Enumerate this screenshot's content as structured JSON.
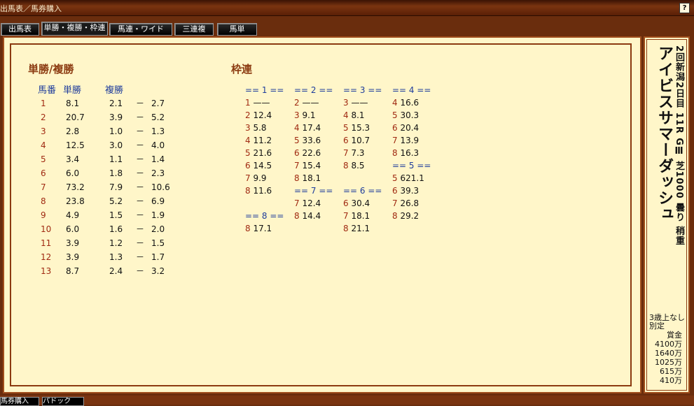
{
  "window": {
    "title": "出馬表／馬券購入",
    "help": "?"
  },
  "tabs": [
    "出馬表",
    "単勝・複勝・枠連",
    "馬連・ワイド",
    "三連複",
    "馬単"
  ],
  "win_place": {
    "title": "単勝/複勝",
    "col_num": "馬番",
    "col_win": "単勝",
    "col_place": "複勝",
    "dash": "－",
    "rows": [
      {
        "n": "1",
        "w": "8.1",
        "p1": "2.1",
        "p2": "2.7"
      },
      {
        "n": "2",
        "w": "20.7",
        "p1": "3.9",
        "p2": "5.2"
      },
      {
        "n": "3",
        "w": "2.8",
        "p1": "1.0",
        "p2": "1.3"
      },
      {
        "n": "4",
        "w": "12.5",
        "p1": "3.0",
        "p2": "4.0"
      },
      {
        "n": "5",
        "w": "3.4",
        "p1": "1.1",
        "p2": "1.4"
      },
      {
        "n": "6",
        "w": "6.0",
        "p1": "1.8",
        "p2": "2.3"
      },
      {
        "n": "7",
        "w": "73.2",
        "p1": "7.9",
        "p2": "10.6"
      },
      {
        "n": "8",
        "w": "23.8",
        "p1": "5.2",
        "p2": "6.9"
      },
      {
        "n": "9",
        "w": "4.9",
        "p1": "1.5",
        "p2": "1.9"
      },
      {
        "n": "10",
        "w": "6.0",
        "p1": "1.6",
        "p2": "2.0"
      },
      {
        "n": "11",
        "w": "3.9",
        "p1": "1.2",
        "p2": "1.5"
      },
      {
        "n": "12",
        "w": "3.9",
        "p1": "1.3",
        "p2": "1.7"
      },
      {
        "n": "13",
        "w": "8.7",
        "p1": "2.4",
        "p2": "3.2"
      }
    ]
  },
  "bracket": {
    "title": "枠連",
    "headers": [
      "== 1 ==",
      "== 2 ==",
      "== 3 ==",
      "== 4 ==",
      "== 5 ==",
      "== 6 ==",
      "== 7 ==",
      "== 8 =="
    ],
    "groups": [
      [
        [
          "1",
          "——"
        ],
        [
          "2",
          "12.4"
        ],
        [
          "3",
          "5.8"
        ],
        [
          "4",
          "11.2"
        ],
        [
          "5",
          "21.6"
        ],
        [
          "6",
          "14.5"
        ],
        [
          "7",
          "9.9"
        ],
        [
          "8",
          "11.6"
        ]
      ],
      [
        [
          "2",
          "——"
        ],
        [
          "3",
          "9.1"
        ],
        [
          "4",
          "17.4"
        ],
        [
          "5",
          "33.6"
        ],
        [
          "6",
          "22.6"
        ],
        [
          "7",
          "15.4"
        ],
        [
          "8",
          "18.1"
        ]
      ],
      [
        [
          "3",
          "——"
        ],
        [
          "4",
          "8.1"
        ],
        [
          "5",
          "15.3"
        ],
        [
          "6",
          "10.7"
        ],
        [
          "7",
          "7.3"
        ],
        [
          "8",
          "8.5"
        ]
      ],
      [
        [
          "4",
          "16.6"
        ],
        [
          "5",
          "30.3"
        ],
        [
          "6",
          "20.4"
        ],
        [
          "7",
          "13.9"
        ],
        [
          "8",
          "16.3"
        ]
      ],
      [
        [
          "5",
          "621.1"
        ],
        [
          "6",
          "39.3"
        ],
        [
          "7",
          "26.8"
        ],
        [
          "8",
          "29.2"
        ]
      ],
      [
        [
          "6",
          "30.4"
        ],
        [
          "7",
          "18.1"
        ],
        [
          "8",
          "21.1"
        ]
      ],
      [
        [
          "7",
          "12.4"
        ],
        [
          "8",
          "14.4"
        ]
      ],
      [
        [
          "8",
          "17.1"
        ]
      ]
    ]
  },
  "race": {
    "name": "アイビスサマーダッシュ",
    "info": "2回新潟2日目 11R GⅢ 芝1000 曇り 稍重",
    "condition1": "3歳上なし",
    "condition2": "別定",
    "prize_label": "賞金",
    "prizes": [
      "4100万",
      "1640万",
      "1025万",
      "615万",
      "410万"
    ]
  },
  "bottom_tabs": [
    "馬券購入",
    "パドック"
  ]
}
